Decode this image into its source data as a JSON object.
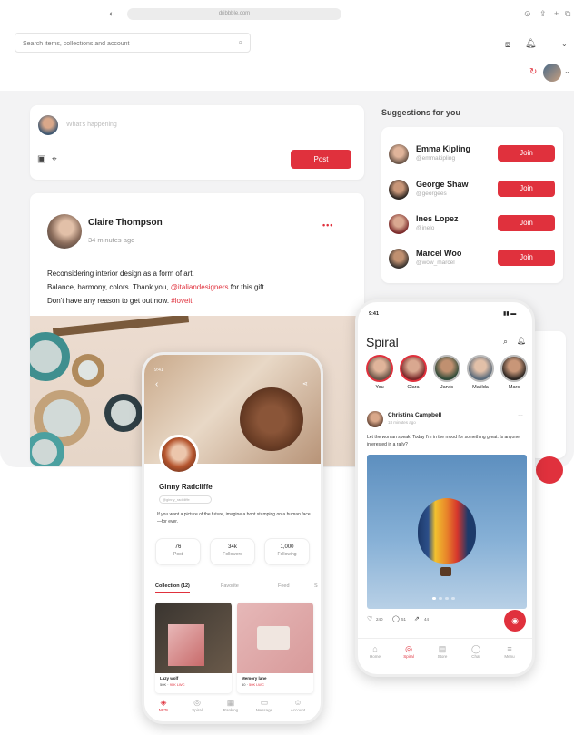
{
  "browser": {
    "url": "dribbble.com",
    "icons": [
      "shield-icon",
      "share-icon",
      "plus-icon",
      "tabs-icon"
    ]
  },
  "header": {
    "search_placeholder": "Search items, collections and account",
    "icons": [
      "calendar-icon",
      "bell-icon",
      "chevron-down-icon",
      "refresh-icon"
    ]
  },
  "composer": {
    "placeholder": "What's happening",
    "post_label": "Post"
  },
  "post": {
    "author": "Claire Thompson",
    "time": "34 minutes ago",
    "more": "•••",
    "line1": "Reconsidering interior design as a form of art.",
    "line2_prefix": "Balance, harmony, colors. Thank you, ",
    "mention": "@italiandesigners",
    "line2_suffix": " for this gift.",
    "line3_prefix": "Don't have any reason to get out now. ",
    "hashtag": "#loveit"
  },
  "suggestions": {
    "title": "Suggestions for you",
    "join_label": "Join",
    "people": [
      {
        "name": "Emma Kipling",
        "handle": "@emmakipling"
      },
      {
        "name": "George Shaw",
        "handle": "@georgees"
      },
      {
        "name": "Ines Lopez",
        "handle": "@inelo"
      },
      {
        "name": "Marcel Woo",
        "handle": "@wow_marcel"
      }
    ]
  },
  "profile_phone": {
    "status_time": "9:41",
    "name": "Ginny Radcliffe",
    "handle": "@ginny_radcliffe",
    "bio": "If you want a picture of the future, imagine a boot stamping on a human face—for ever.",
    "stats": [
      {
        "value": "76",
        "label": "Post"
      },
      {
        "value": "34k",
        "label": "Followers"
      },
      {
        "value": "1,000",
        "label": "Following"
      }
    ],
    "tabs": [
      "Collection (12)",
      "Favorite",
      "Feed",
      "S"
    ],
    "items": [
      {
        "title": "Lazy wolf",
        "price": "50K",
        "extra": "90K LWC"
      },
      {
        "title": "Memory lane",
        "price": "50",
        "extra": "50K LWC"
      }
    ],
    "nav": [
      "NFTs",
      "Spiral",
      "Ranking",
      "Message",
      "Account"
    ]
  },
  "feed_phone": {
    "status_time": "9:41",
    "app_name": "Spiral",
    "stories": [
      "You",
      "Clara",
      "Jarvis",
      "Matilda",
      "Marc"
    ],
    "post_author": "Christina Campbell",
    "post_time": "18 minutes ago",
    "post_text": "Let the woman speak! Today I'm in the mood for something great. Is anyone interested in a rally?",
    "likes": "240",
    "comments": "51",
    "shares": "44",
    "nav": [
      "Home",
      "Spiral",
      "Store",
      "Chat",
      "Menu"
    ]
  },
  "colors": {
    "accent": "#e0313d",
    "background": "#f3f3f4",
    "card": "#ffffff"
  }
}
